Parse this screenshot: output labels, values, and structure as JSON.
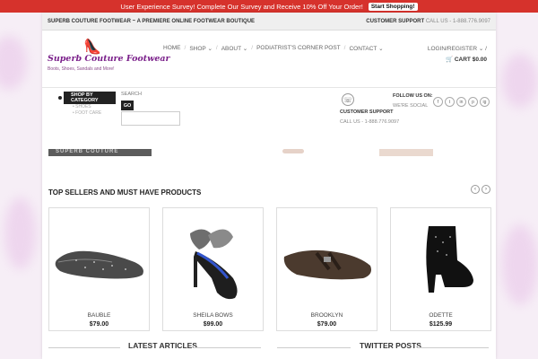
{
  "survey": {
    "message": "User Experience Survey! Complete Our Survey and Receive 10% Off Your Order!",
    "button": "Start Shopping!"
  },
  "topstrip": {
    "brand_line": "Superb Couture Footwear ~ A Premiere Online Footwear Boutique",
    "support_label": "Customer Support",
    "support_phone": "Call Us - 1-888.776.9097"
  },
  "logo": {
    "name": "Superb Couture Footwear",
    "tagline": "Boots, Shoes, Sandals and More!"
  },
  "nav": {
    "home": "Home",
    "shop": "Shop",
    "about": "About",
    "podiatrist": "Podiatrist's Corner Post",
    "contact": "Contact"
  },
  "account": {
    "login": "Login/Register",
    "cart_label": "Cart",
    "cart_total": "$0.00"
  },
  "subbar": {
    "shop_by": "Shop by Category",
    "categories": [
      "Shoes",
      "Foot Care"
    ],
    "search_label": "Search",
    "go": "GO",
    "search_value": ""
  },
  "support_box": {
    "title": "Customer Support",
    "phone": "Call Us - 1-888.776.9097"
  },
  "follow": {
    "title": "Follow Us On:",
    "subtitle": "We're Social",
    "icons": [
      "f",
      "t",
      "in",
      "p",
      "ig"
    ]
  },
  "banner_text": "SUPERB COUTURE",
  "section": {
    "title": "Top Sellers and Must Have Products"
  },
  "products": [
    {
      "name": "Bauble",
      "price": "$79.00"
    },
    {
      "name": "Sheila Bows",
      "price": "$99.00"
    },
    {
      "name": "Brooklyn",
      "price": "$79.00"
    },
    {
      "name": "Odette",
      "price": "$125.99"
    }
  ],
  "footer": {
    "articles": "Latest Articles",
    "twitter": "Twitter Posts"
  },
  "colors": {
    "survey_bg": "#d6322c",
    "accent_purple": "#7a1f8a"
  }
}
